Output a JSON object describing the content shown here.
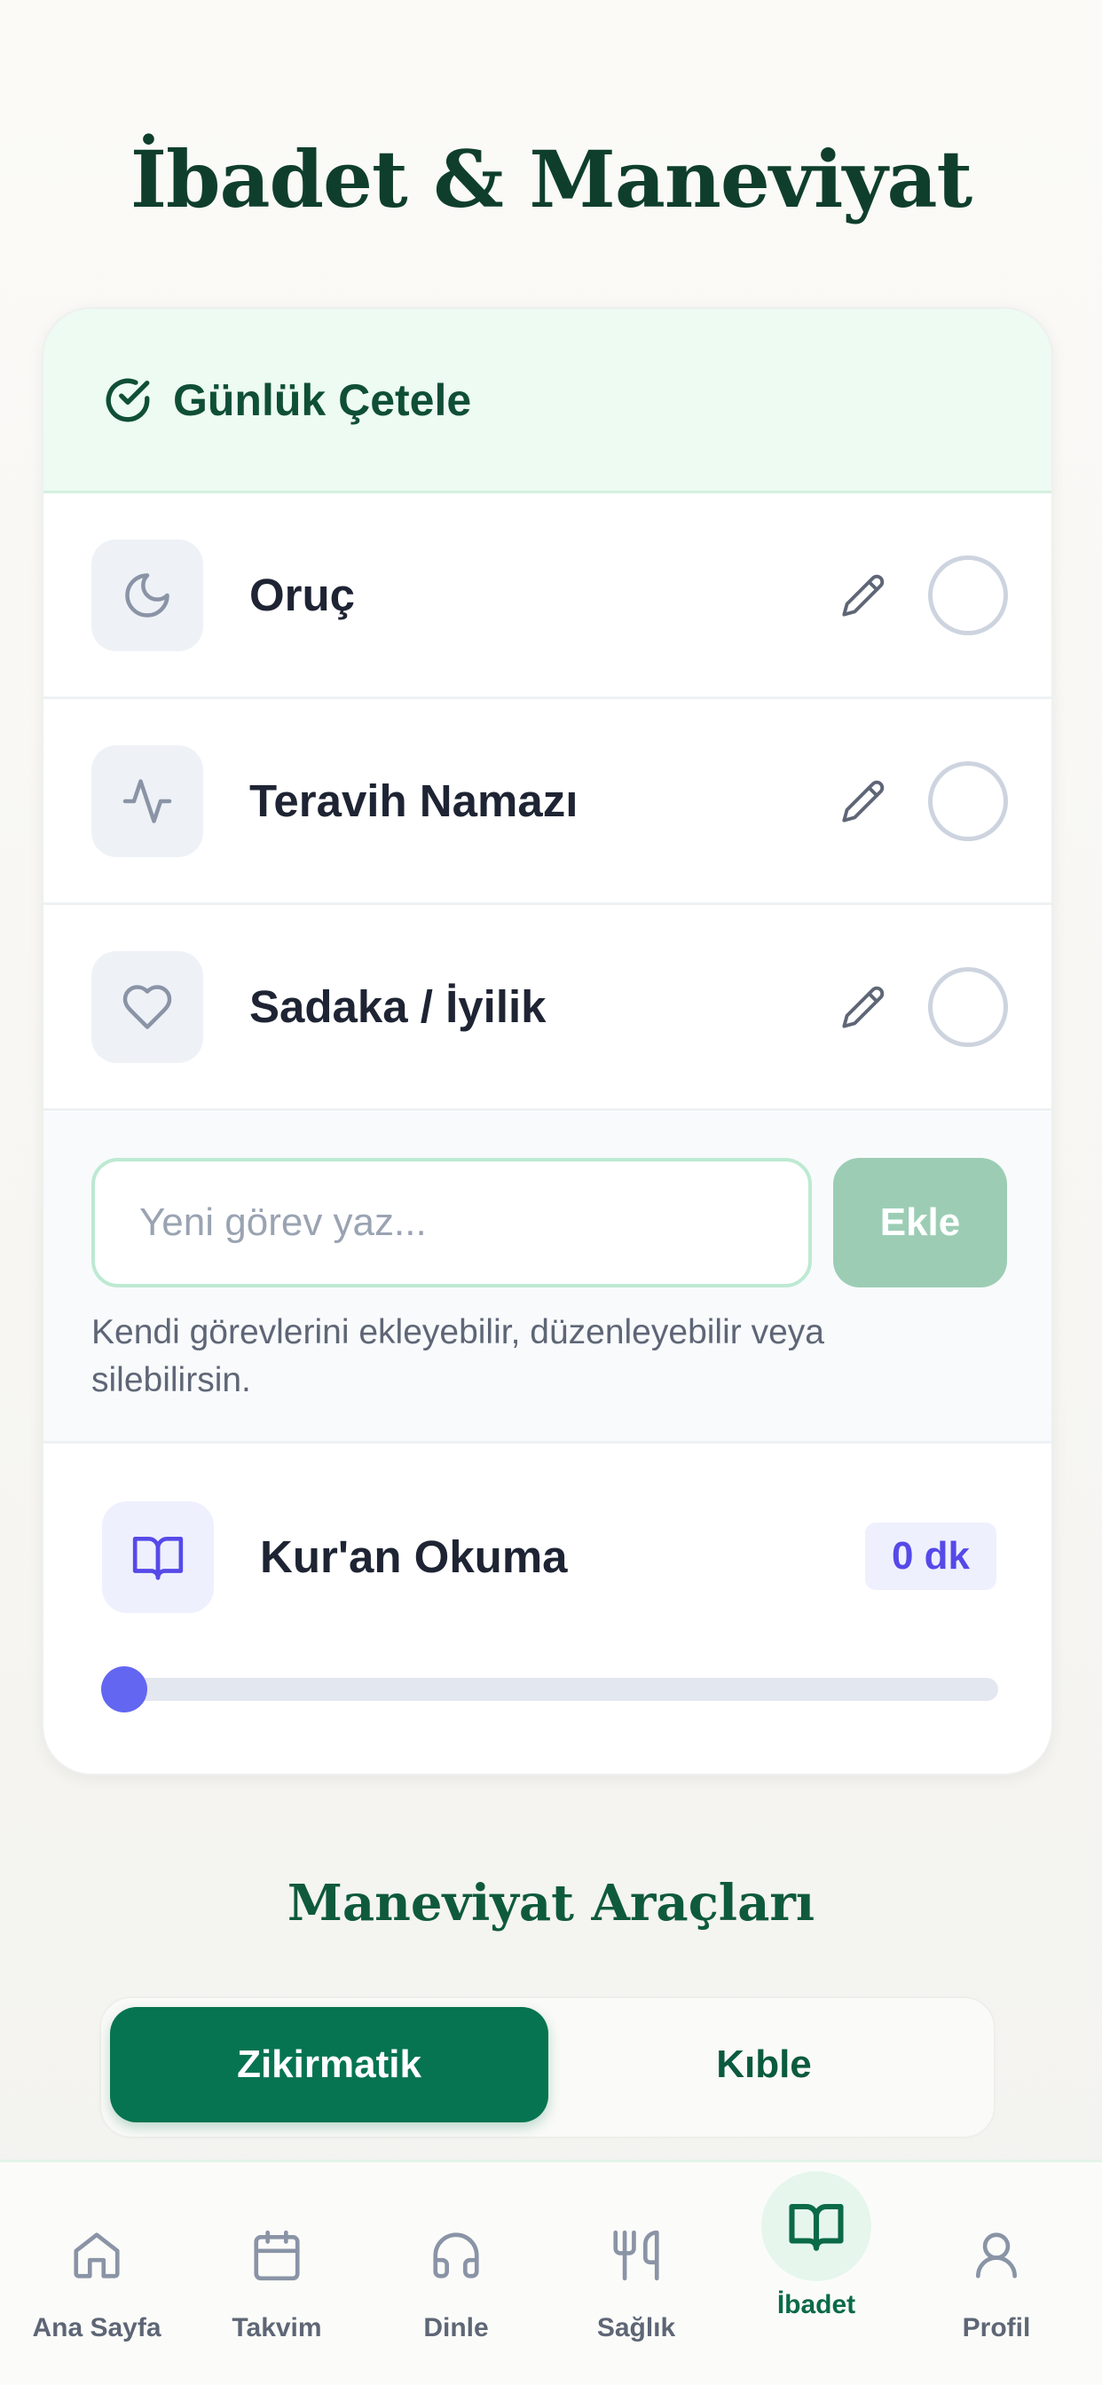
{
  "page": {
    "title": "İbadet & Maneviyat"
  },
  "checklist": {
    "title": "Günlük Çetele",
    "icon": "check-circle-icon",
    "tasks": [
      {
        "label": "Oruç",
        "icon": "moon-icon",
        "done": false
      },
      {
        "label": "Teravih Namazı",
        "icon": "activity-icon",
        "done": false
      },
      {
        "label": "Sadaka / İyilik",
        "icon": "heart-icon",
        "done": false
      }
    ],
    "new_task": {
      "placeholder": "Yeni görev yaz...",
      "value": "",
      "add_label": "Ekle",
      "hint": "Kendi görevlerini ekleyebilir, düzenleyebilir veya silebilirsin."
    },
    "quran": {
      "label": "Kur'an Okuma",
      "icon": "book-open-icon",
      "minutes_label": "0 dk",
      "minutes": 0,
      "slider_fraction": 0
    }
  },
  "tools": {
    "title": "Maneviyat Araçları",
    "tabs": [
      {
        "label": "Zikirmatik",
        "active": true
      },
      {
        "label": "Kıble",
        "active": false
      }
    ]
  },
  "nav": {
    "items": [
      {
        "label": "Ana Sayfa",
        "icon": "home-icon",
        "active": false
      },
      {
        "label": "Takvim",
        "icon": "calendar-icon",
        "active": false
      },
      {
        "label": "Dinle",
        "icon": "headphones-icon",
        "active": false
      },
      {
        "label": "Sağlık",
        "icon": "utensils-icon",
        "active": false
      },
      {
        "label": "İbadet",
        "icon": "book-open-icon",
        "active": true
      },
      {
        "label": "Profil",
        "icon": "user-icon",
        "active": false
      }
    ]
  },
  "colors": {
    "primary": "#067451",
    "heading": "#0f3f2c",
    "accent_indigo": "#6366f1",
    "header_bg": "#edfbf2"
  }
}
